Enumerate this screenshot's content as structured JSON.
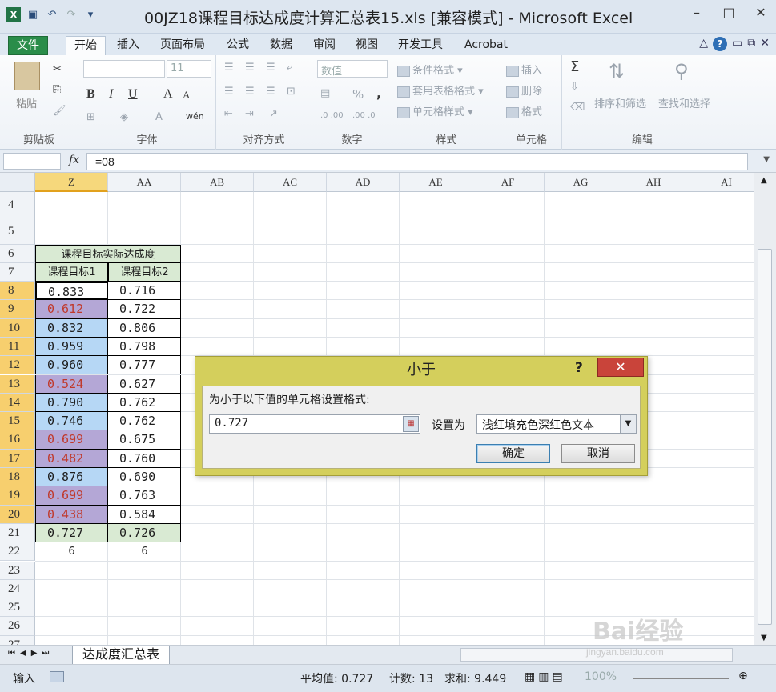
{
  "window": {
    "title": "00JZ18课程目标达成度计算汇总表15.xls  [兼容模式] - Microsoft Excel",
    "min": "–",
    "max": "□",
    "close": "✕"
  },
  "ribbon_tabs": [
    "文件",
    "开始",
    "插入",
    "页面布局",
    "公式",
    "数据",
    "审阅",
    "视图",
    "开发工具",
    "Acrobat"
  ],
  "ribbon": {
    "clipboard": {
      "label": "剪贴板",
      "paste": "粘贴"
    },
    "font": {
      "label": "字体",
      "size": "11",
      "bold": "B",
      "italic": "I",
      "underline": "U",
      "grow": "A",
      "shrink": "A"
    },
    "align": {
      "label": "对齐方式"
    },
    "number": {
      "label": "数字",
      "format": "数值",
      "percent": "%",
      "comma": ","
    },
    "styles": {
      "label": "样式",
      "cond": "条件格式",
      "table": "套用表格格式",
      "cell": "单元格样式"
    },
    "cells": {
      "label": "单元格",
      "insert": "插入",
      "delete": "删除",
      "format": "格式"
    },
    "editing": {
      "label": "编辑",
      "sigma": "Σ",
      "sort": "排序和筛选",
      "find": "查找和选择"
    }
  },
  "formula_bar": {
    "fx": "fx",
    "formula": "=08"
  },
  "columns": [
    "Z",
    "AA",
    "AB",
    "AC",
    "AD",
    "AE",
    "AF",
    "AG",
    "AH",
    "AI"
  ],
  "rows": [
    "4",
    "5",
    "6",
    "7",
    "8",
    "9",
    "10",
    "11",
    "12",
    "13",
    "14",
    "15",
    "16",
    "17",
    "18",
    "19",
    "20",
    "21",
    "22",
    "23",
    "24",
    "25",
    "26",
    "27"
  ],
  "table": {
    "title": "课程目标实际达成度",
    "head": [
      "课程目标1",
      "课程目标2"
    ],
    "data": [
      [
        "0.833",
        "0.716"
      ],
      [
        "0.612",
        "0.722"
      ],
      [
        "0.832",
        "0.806"
      ],
      [
        "0.959",
        "0.798"
      ],
      [
        "0.960",
        "0.777"
      ],
      [
        "0.524",
        "0.627"
      ],
      [
        "0.790",
        "0.762"
      ],
      [
        "0.746",
        "0.762"
      ],
      [
        "0.699",
        "0.675"
      ],
      [
        "0.482",
        "0.760"
      ],
      [
        "0.876",
        "0.690"
      ],
      [
        "0.699",
        "0.763"
      ],
      [
        "0.438",
        "0.584"
      ]
    ],
    "avg": [
      "0.727",
      "0.726"
    ],
    "count": [
      "6",
      "6"
    ]
  },
  "dialog": {
    "title": "小于",
    "help": "?",
    "close": "✕",
    "prompt": "为小于以下值的单元格设置格式:",
    "value": "0.727",
    "set_label": "设置为",
    "format_option": "浅红填充色深红色文本",
    "ok": "确定",
    "cancel": "取消"
  },
  "sheet_tabs": [
    "达成度汇总表"
  ],
  "status": {
    "mode": "输入",
    "average": "平均值: 0.727",
    "count": "计数: 13",
    "sum": "求和: 9.449",
    "zoom": "100%"
  },
  "watermark": {
    "brand": "Bai经验",
    "url": "jingyan.baidu.com"
  },
  "colors": {
    "low_fill": "#b4a7d6",
    "high_fill": "#b6d7f5",
    "red_text": "#c0392b",
    "header_fill": "#d9ead3",
    "selection": "#f6d87c"
  }
}
